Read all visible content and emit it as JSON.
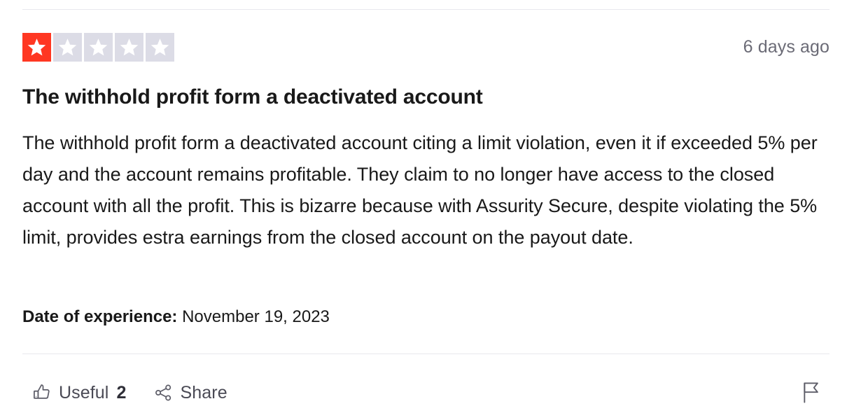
{
  "review": {
    "rating": 1,
    "max_rating": 5,
    "star_filled_color": "#ff3722",
    "star_empty_color": "#dcdce6",
    "timestamp": "6 days ago",
    "title": "The withhold profit form a deactivated account",
    "body": "The withhold profit form a deactivated account citing a limit violation, even it if exceeded 5% per day and the account remains profitable. They claim to no longer have access to the closed account with all the profit. This is bizarre because with Assurity Secure, despite violating the 5% limit, provides estra earnings from the closed account on the payout date.",
    "experience": {
      "label": "Date of experience:",
      "value": "November 19, 2023"
    }
  },
  "footer": {
    "useful_label": "Useful",
    "useful_count": "2",
    "share_label": "Share",
    "useful_icon": "thumbs-up-icon",
    "share_icon": "share-nodes-icon",
    "report_icon": "flag-icon"
  }
}
